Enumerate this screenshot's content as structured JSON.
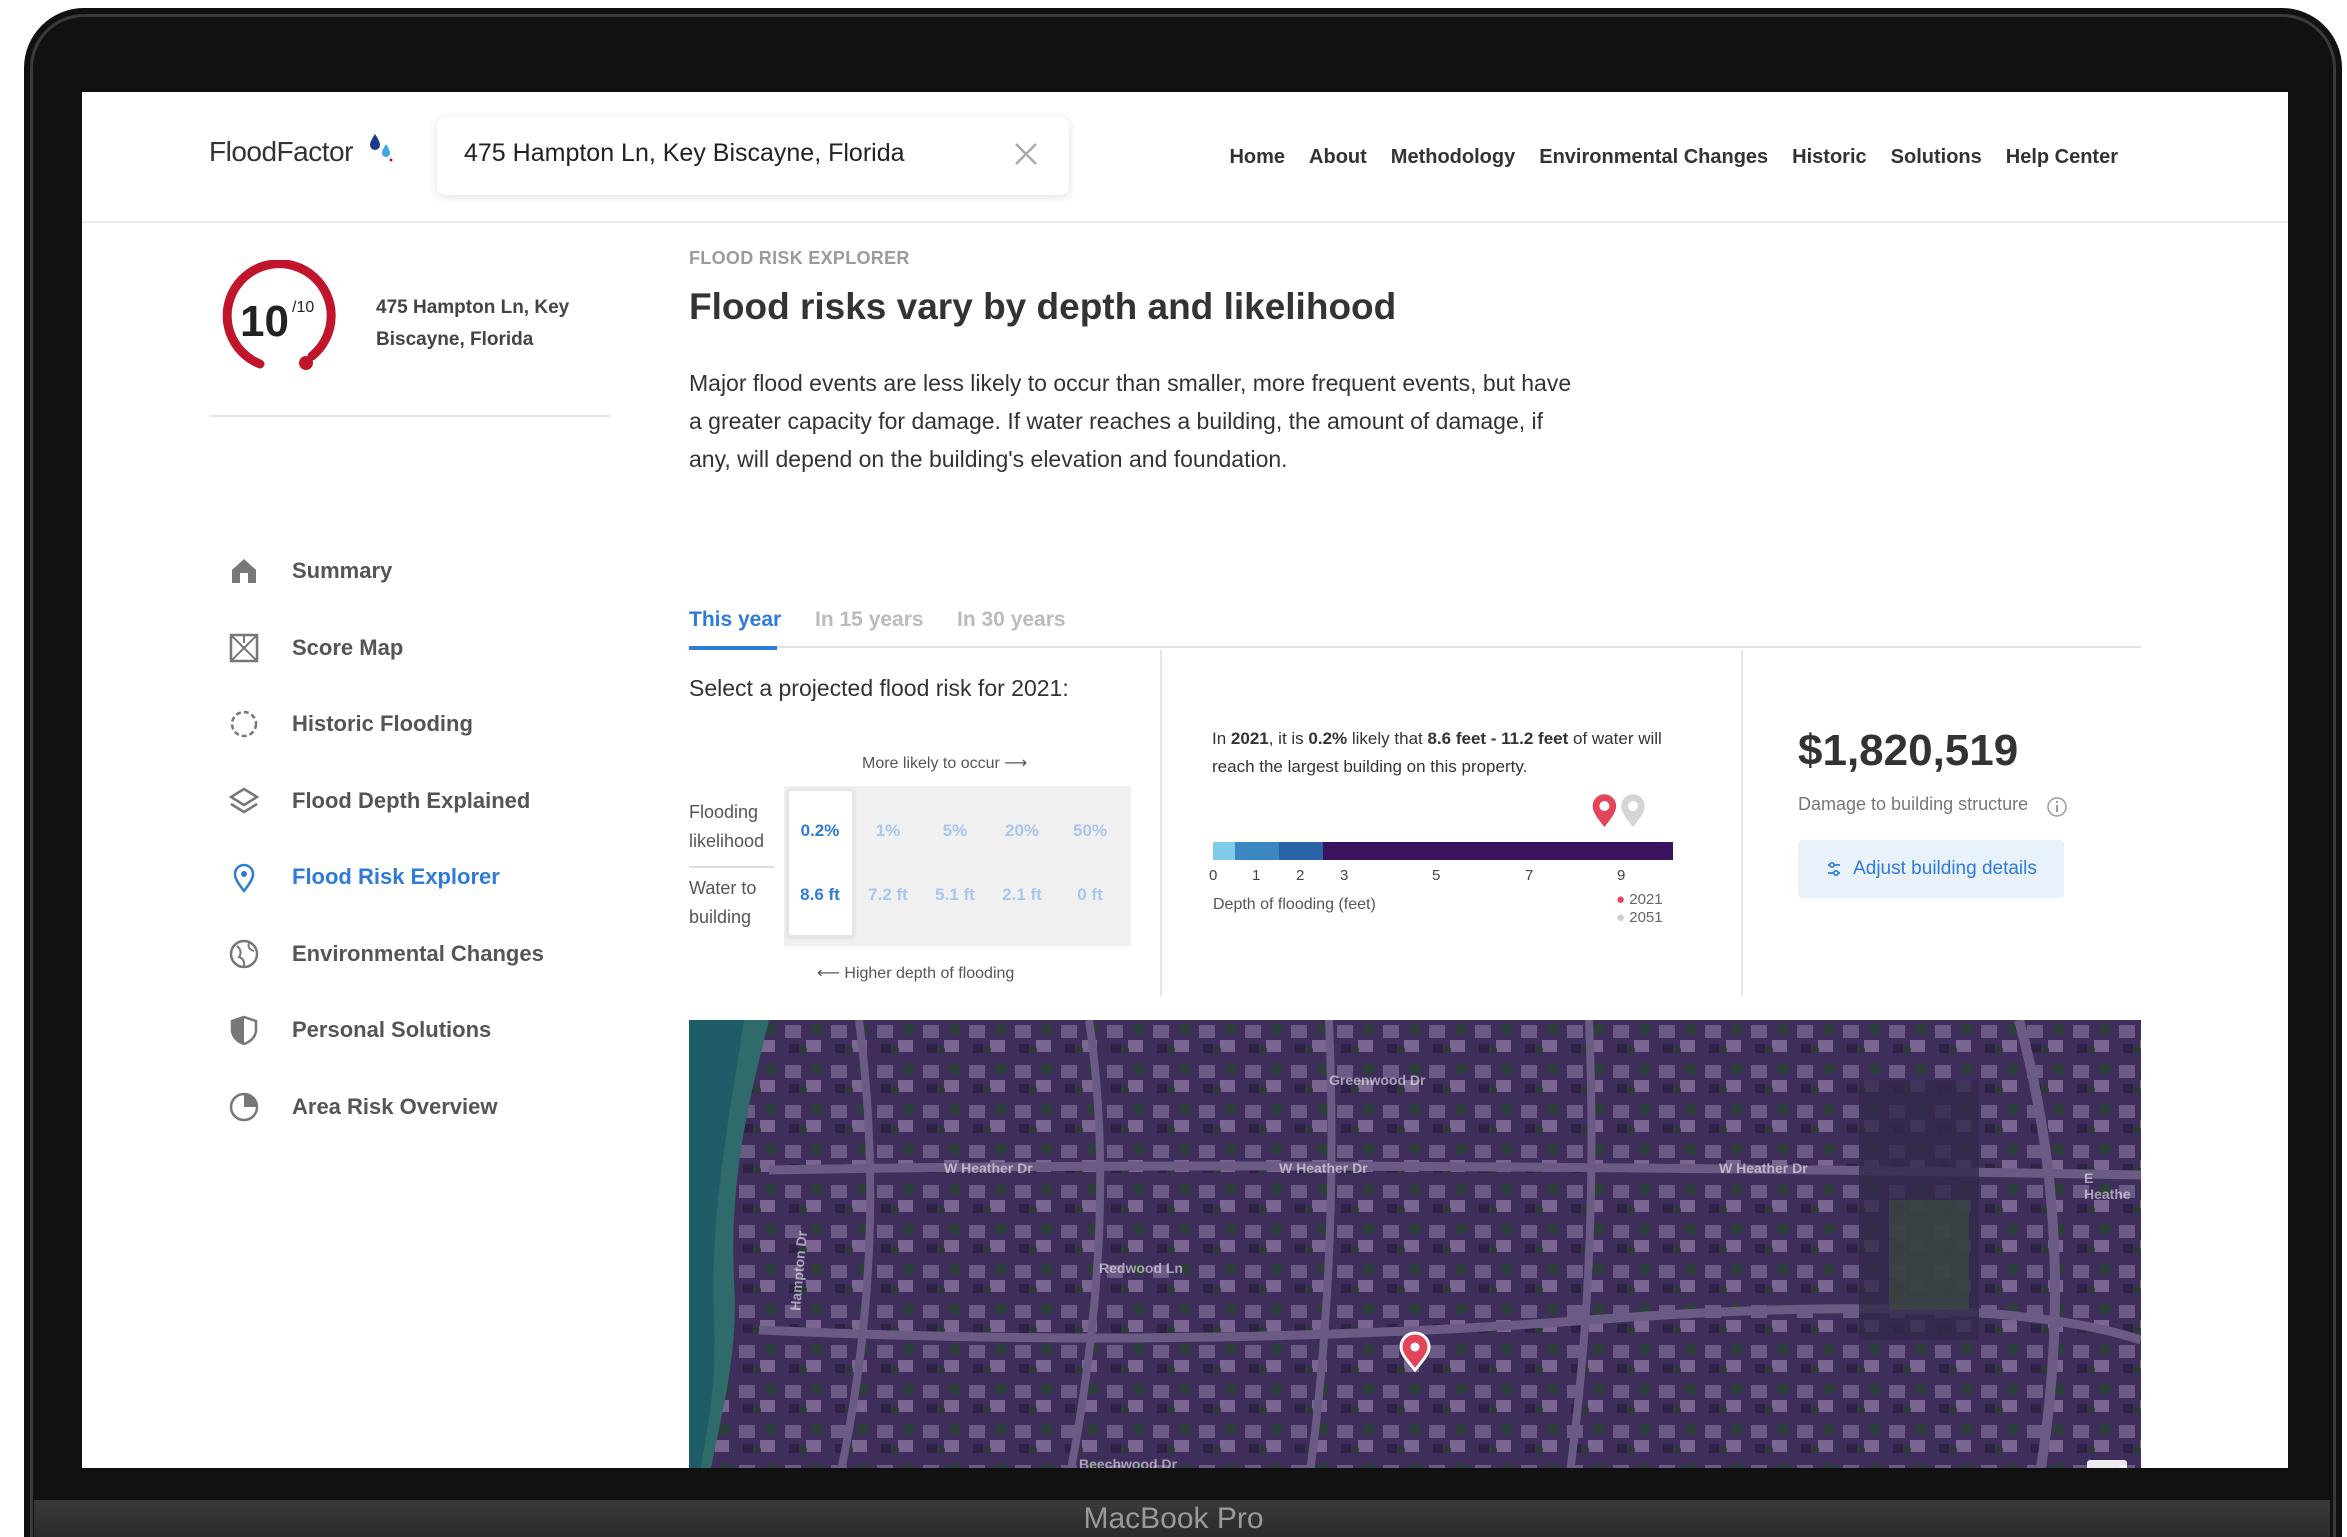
{
  "device": {
    "label": "MacBook Pro"
  },
  "header": {
    "logo": "FloodFactor",
    "search": {
      "value": "475 Hampton Ln, Key Biscayne, Florida"
    },
    "nav": [
      "Home",
      "About",
      "Methodology",
      "Environmental Changes",
      "Historic",
      "Solutions",
      "Help Center"
    ]
  },
  "sidebar": {
    "score": "10",
    "score_max": "/10",
    "address": "475 Hampton Ln, Key Biscayne, Florida",
    "items": [
      {
        "label": "Summary",
        "icon": "home-icon"
      },
      {
        "label": "Score Map",
        "icon": "map-icon"
      },
      {
        "label": "Historic Flooding",
        "icon": "history-icon"
      },
      {
        "label": "Flood Depth Explained",
        "icon": "layers-icon"
      },
      {
        "label": "Flood Risk Explorer",
        "icon": "pin-icon",
        "active": true
      },
      {
        "label": "Environmental Changes",
        "icon": "globe-icon"
      },
      {
        "label": "Personal Solutions",
        "icon": "shield-icon"
      },
      {
        "label": "Area Risk Overview",
        "icon": "pie-icon"
      }
    ]
  },
  "main": {
    "eyebrow": "FLOOD RISK EXPLORER",
    "title": "Flood risks vary by depth and likelihood",
    "description": "Major flood events are less likely to occur than smaller, more frequent events, but have a greater capacity for damage. If water reaches a building, the amount of damage, if any, will depend on the building's elevation and foundation.",
    "tabs": [
      "This year",
      "In 15 years",
      "In 30 years"
    ],
    "select_title": "Select a projected flood risk for 2021:",
    "more_likely": "More likely to occur",
    "higher_depth": "Higher depth of flooding",
    "row_labels": {
      "likelihood": [
        "Flooding",
        "likelihood"
      ],
      "water": [
        "Water to",
        "building"
      ]
    },
    "likelihoods": [
      "0.2%",
      "1%",
      "5%",
      "20%",
      "50%"
    ],
    "depths": [
      "8.6 ft",
      "7.2 ft",
      "5.1 ft",
      "2.1 ft",
      "0 ft"
    ],
    "sentence": {
      "p1": "In ",
      "year": "2021",
      "p2": ", it is ",
      "likelihood": "0.2%",
      "p3": " likely that ",
      "range": "8.6 feet - 11.2 feet",
      "p4": " of water will reach the largest building on this property."
    },
    "depth_scale": [
      "0",
      "1",
      "2",
      "3",
      "5",
      "7",
      "9"
    ],
    "depth_label": "Depth of flooding (feet)",
    "legend_years": [
      "2021",
      "2051"
    ],
    "depth_marker_2021_ft": 8.6,
    "depth_marker_2051_ft": 9.4,
    "damage_value": "$1,820,519",
    "damage_label": "Damage to building structure",
    "adjust_button": "Adjust building details",
    "map_streets": [
      "Greenwood Dr",
      "W Heather Dr",
      "W Heather Dr",
      "W Heather Dr",
      "E Heathe",
      "Redwood Ln",
      "Beechwood Dr",
      "Hampton Dr"
    ]
  },
  "colors": {
    "accent": "#2f7bd8",
    "score_red": "#c0162b",
    "depth_dark": "#3b1360"
  }
}
